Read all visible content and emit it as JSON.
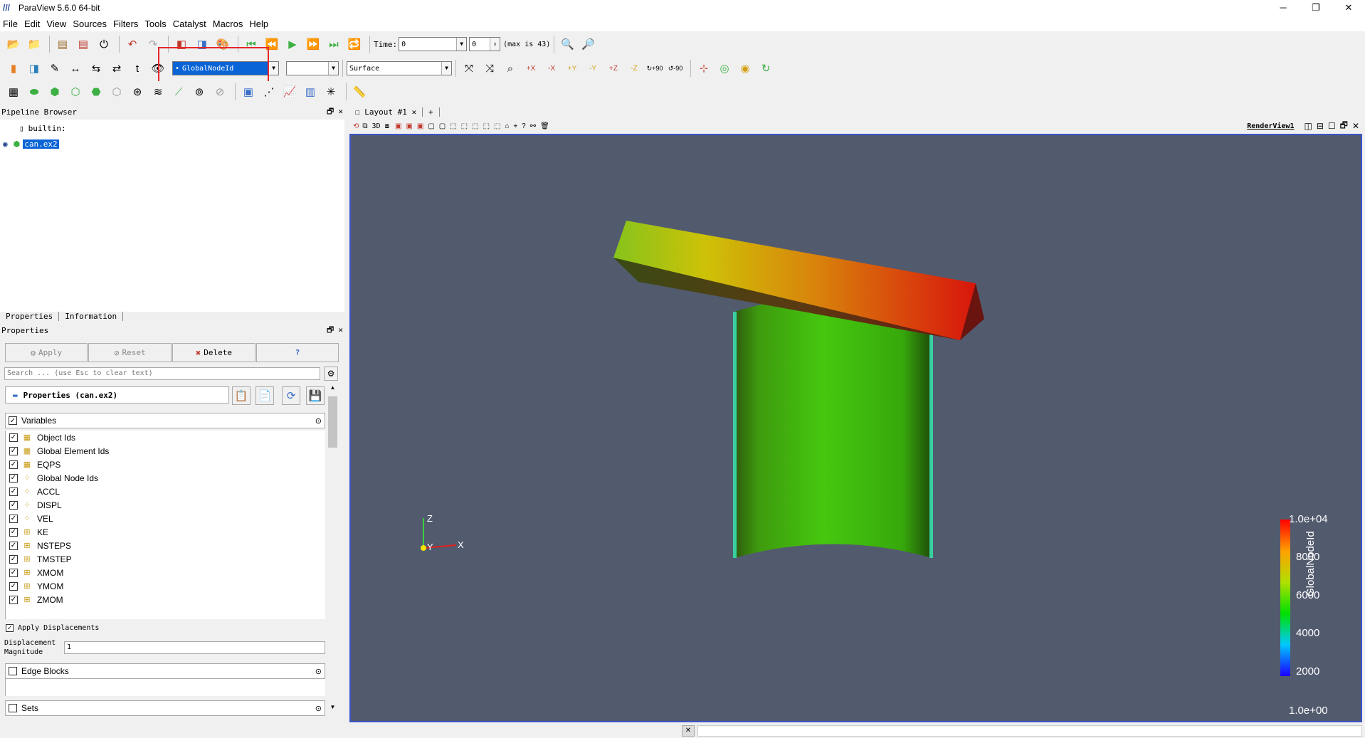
{
  "window": {
    "title": "ParaView 5.6.0 64-bit"
  },
  "menu": [
    "File",
    "Edit",
    "View",
    "Sources",
    "Filters",
    "Tools",
    "Catalyst",
    "Macros",
    "Help"
  ],
  "toolbar": {
    "time_label": "Time:",
    "time_value": "0",
    "timestep_value": "0",
    "max_label": "(max is 43)",
    "color_by": "GlobalNodeId",
    "component": "",
    "representation": "Surface",
    "rotate_plus": "+90",
    "rotate_minus": "-90"
  },
  "pipeline": {
    "title": "Pipeline Browser",
    "root": "builtin:",
    "item": "can.ex2"
  },
  "tabs": {
    "properties": "Properties",
    "information": "Information"
  },
  "properties": {
    "title": "Properties",
    "apply": "Apply",
    "reset": "Reset",
    "delete": "Delete",
    "help": "?",
    "search_placeholder": "Search ... (use Esc to clear text)",
    "section_title": "Properties (can.ex2)",
    "variables_label": "Variables",
    "variables": [
      "Object Ids",
      "Global Element Ids",
      "EQPS",
      "Global Node Ids",
      "ACCL",
      "DISPL",
      "VEL",
      "KE",
      "NSTEPS",
      "TMSTEP",
      "XMOM",
      "YMOM",
      "ZMOM"
    ],
    "apply_displacements": "Apply Displacements",
    "displacement_magnitude_label_1": "Displacement",
    "displacement_magnitude_label_2": "Magnitude",
    "displacement_magnitude": "1",
    "edge_blocks": "Edge Blocks",
    "sets": "Sets"
  },
  "layout": {
    "tab": "Layout #1",
    "add_tab": "+",
    "mode_3d": "3D",
    "render_view": "RenderView1"
  },
  "colorbar": {
    "title": "GlobalNodeId",
    "labels": [
      "1.0e+04",
      "8000",
      "6000",
      "4000",
      "2000",
      "1.0e+00"
    ]
  },
  "axes": {
    "z": "Z",
    "y": "Y",
    "x": "X"
  },
  "colors": {
    "background": "#525a6e",
    "selection": "#0a64d6",
    "highlight_box": "#e8262a"
  }
}
